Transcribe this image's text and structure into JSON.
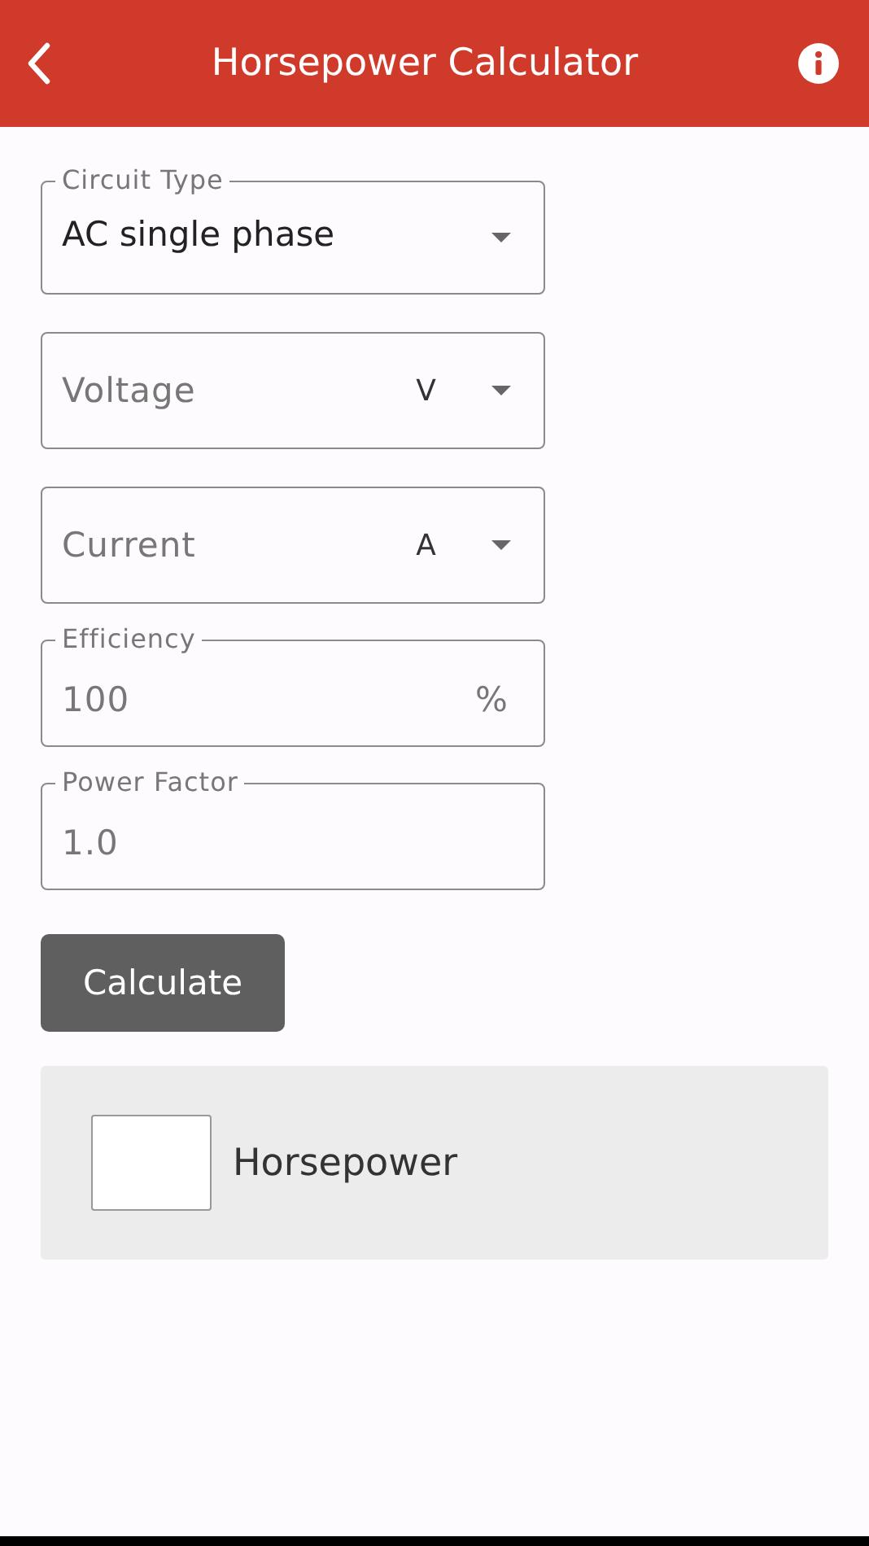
{
  "header": {
    "title": "Horsepower Calculator"
  },
  "fields": [
    {
      "kind": "select",
      "label": "Circuit Type",
      "value": "AC single phase"
    },
    {
      "kind": "unit_input",
      "placeholder": "Voltage",
      "unit": "V"
    },
    {
      "kind": "unit_input",
      "placeholder": "Current",
      "unit": "A"
    },
    {
      "kind": "input",
      "label": "Efficiency",
      "placeholder": "100",
      "suffix": "%"
    },
    {
      "kind": "input",
      "label": "Power Factor",
      "placeholder": "1.0"
    }
  ],
  "button": "Calculate",
  "result": {
    "label": "Horsepower"
  }
}
